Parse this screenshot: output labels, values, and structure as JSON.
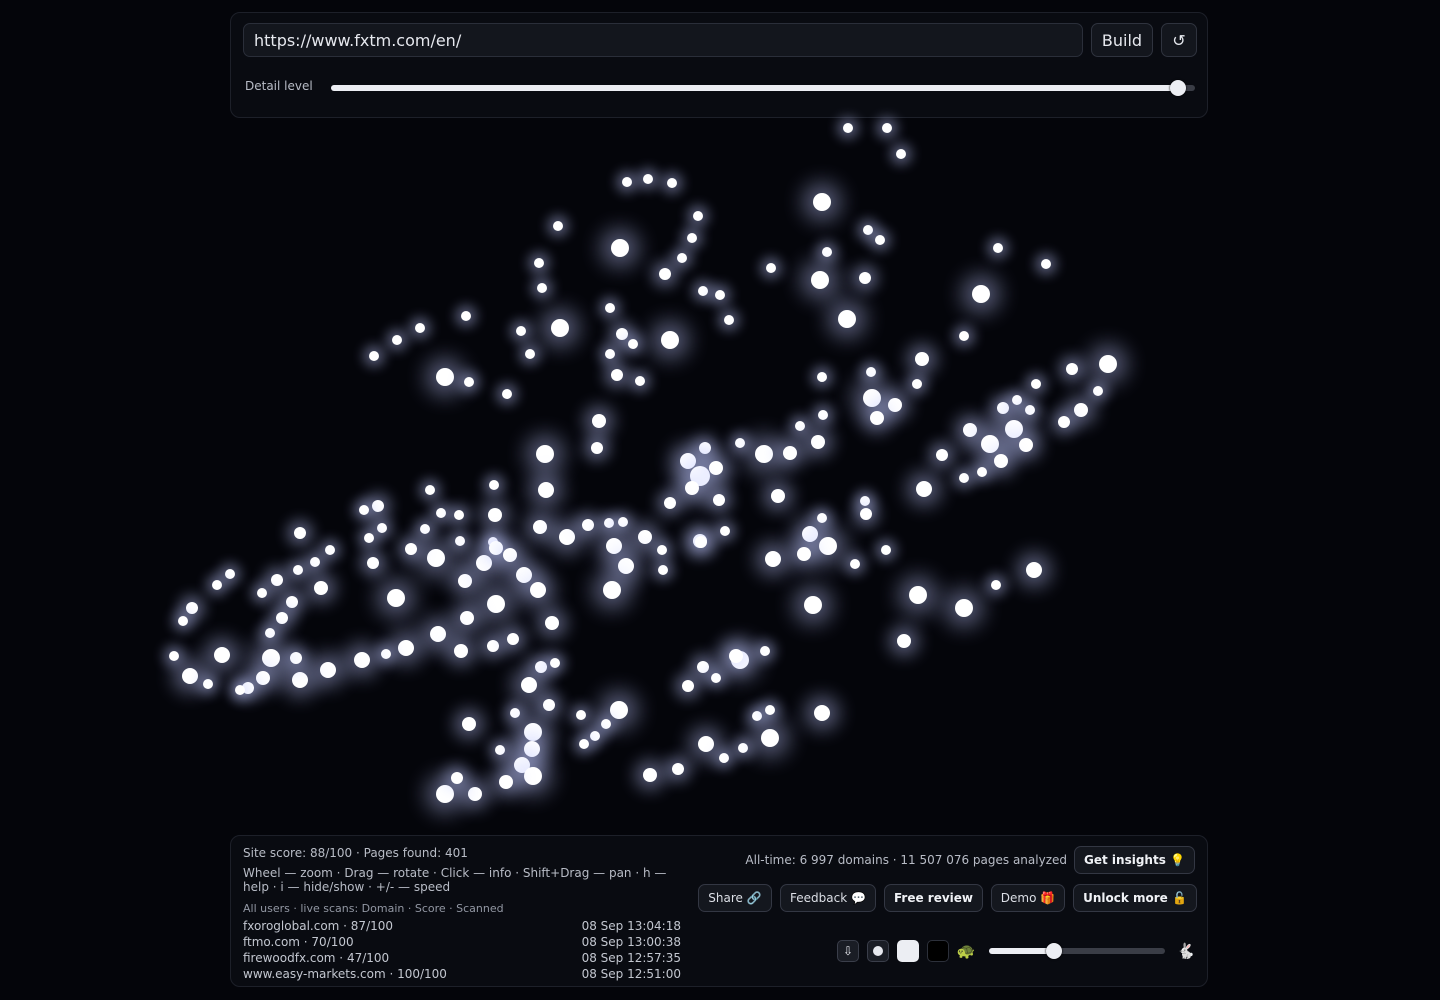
{
  "toolbar": {
    "url_value": "https://www.fxtm.com/en/",
    "build_label": "Build",
    "refresh_icon": "↺",
    "detail_label": "Detail level",
    "detail_level": 0.98
  },
  "graph": {
    "node_color": "#ffffff"
  },
  "footer": {
    "site_score": "Site score: 88/100 · Pages found: 401",
    "help_text": "Wheel — zoom · Drag — rotate · Click — info · Shift+Drag — pan · h — help · i — hide/show · +/- — speed",
    "scans_header": "All users · live scans: Domain · Score · Scanned",
    "scans": [
      {
        "domain": "fxoroglobal.com · 87/100",
        "time": "08 Sep 13:04:18"
      },
      {
        "domain": "ftmo.com · 70/100",
        "time": "08 Sep 13:00:38"
      },
      {
        "domain": "firewoodfx.com · 47/100",
        "time": "08 Sep 12:57:35"
      },
      {
        "domain": "www.easy-markets.com · 100/100",
        "time": "08 Sep 12:51:00"
      }
    ],
    "alltime": "All-time: 6 997 domains · 11 507 076 pages analyzed",
    "insights_label": "Get insights 💡",
    "share_label": "Share 🔗",
    "feedback_label": "Feedback 💬",
    "review_label": "Free review",
    "demo_label": "Demo 🎁",
    "unlock_label": "Unlock more 🔓",
    "download_icon": "⇩",
    "turtle_icon": "🐢",
    "rabbit_icon": "🐇",
    "speed_level": 0.37
  }
}
